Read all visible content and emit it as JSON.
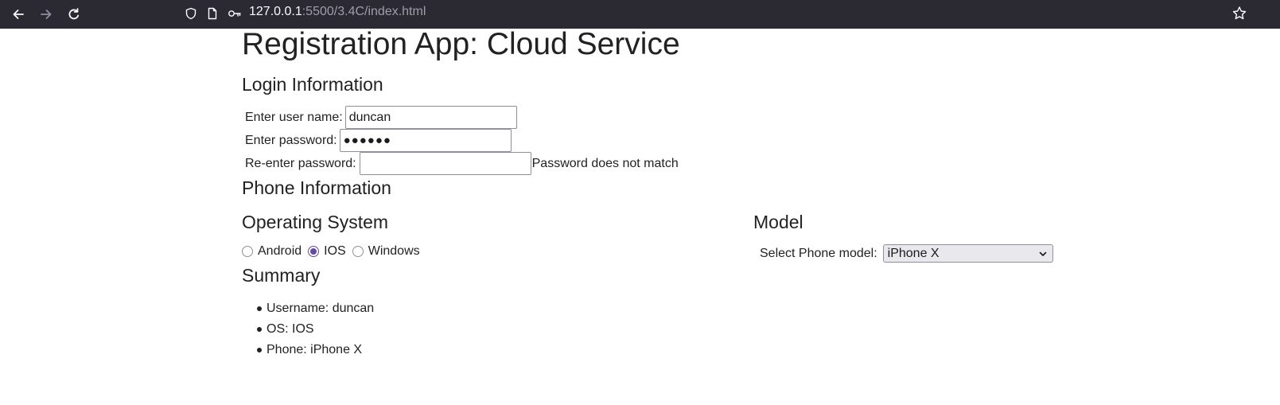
{
  "browser": {
    "url_host": "127.0.0.1",
    "url_rest": ":5500/3.4C/index.html"
  },
  "page": {
    "title": "Registration App: Cloud Service",
    "login_heading": "Login Information",
    "username_label": "Enter user name:",
    "username_value": "duncan",
    "password_label": "Enter password:",
    "password_value": "●●●●●●",
    "reenter_label": "Re-enter password:",
    "reenter_value": "",
    "mismatch_message": "Password does not match",
    "phone_heading": "Phone Information",
    "os_heading": "Operating System",
    "os_options": [
      {
        "label": "Android",
        "checked": false
      },
      {
        "label": "IOS",
        "checked": true
      },
      {
        "label": "Windows",
        "checked": false
      }
    ],
    "model_heading": "Model",
    "model_label": "Select Phone model:",
    "model_selected": "iPhone X",
    "summary_heading": "Summary",
    "summary_items": [
      "Username: duncan",
      "OS: IOS",
      "Phone: iPhone X"
    ]
  },
  "colors": {
    "toolbar_bg": "#2b2a33",
    "radio_accent": "#6549a6",
    "text": "#222222"
  },
  "icons": {
    "back": "arrow-left-icon",
    "forward": "arrow-right-icon",
    "reload": "reload-icon",
    "shield": "shield-icon",
    "page": "page-icon",
    "key": "key-icon",
    "star": "star-icon",
    "select_arrow": "chevron-down-icon"
  }
}
